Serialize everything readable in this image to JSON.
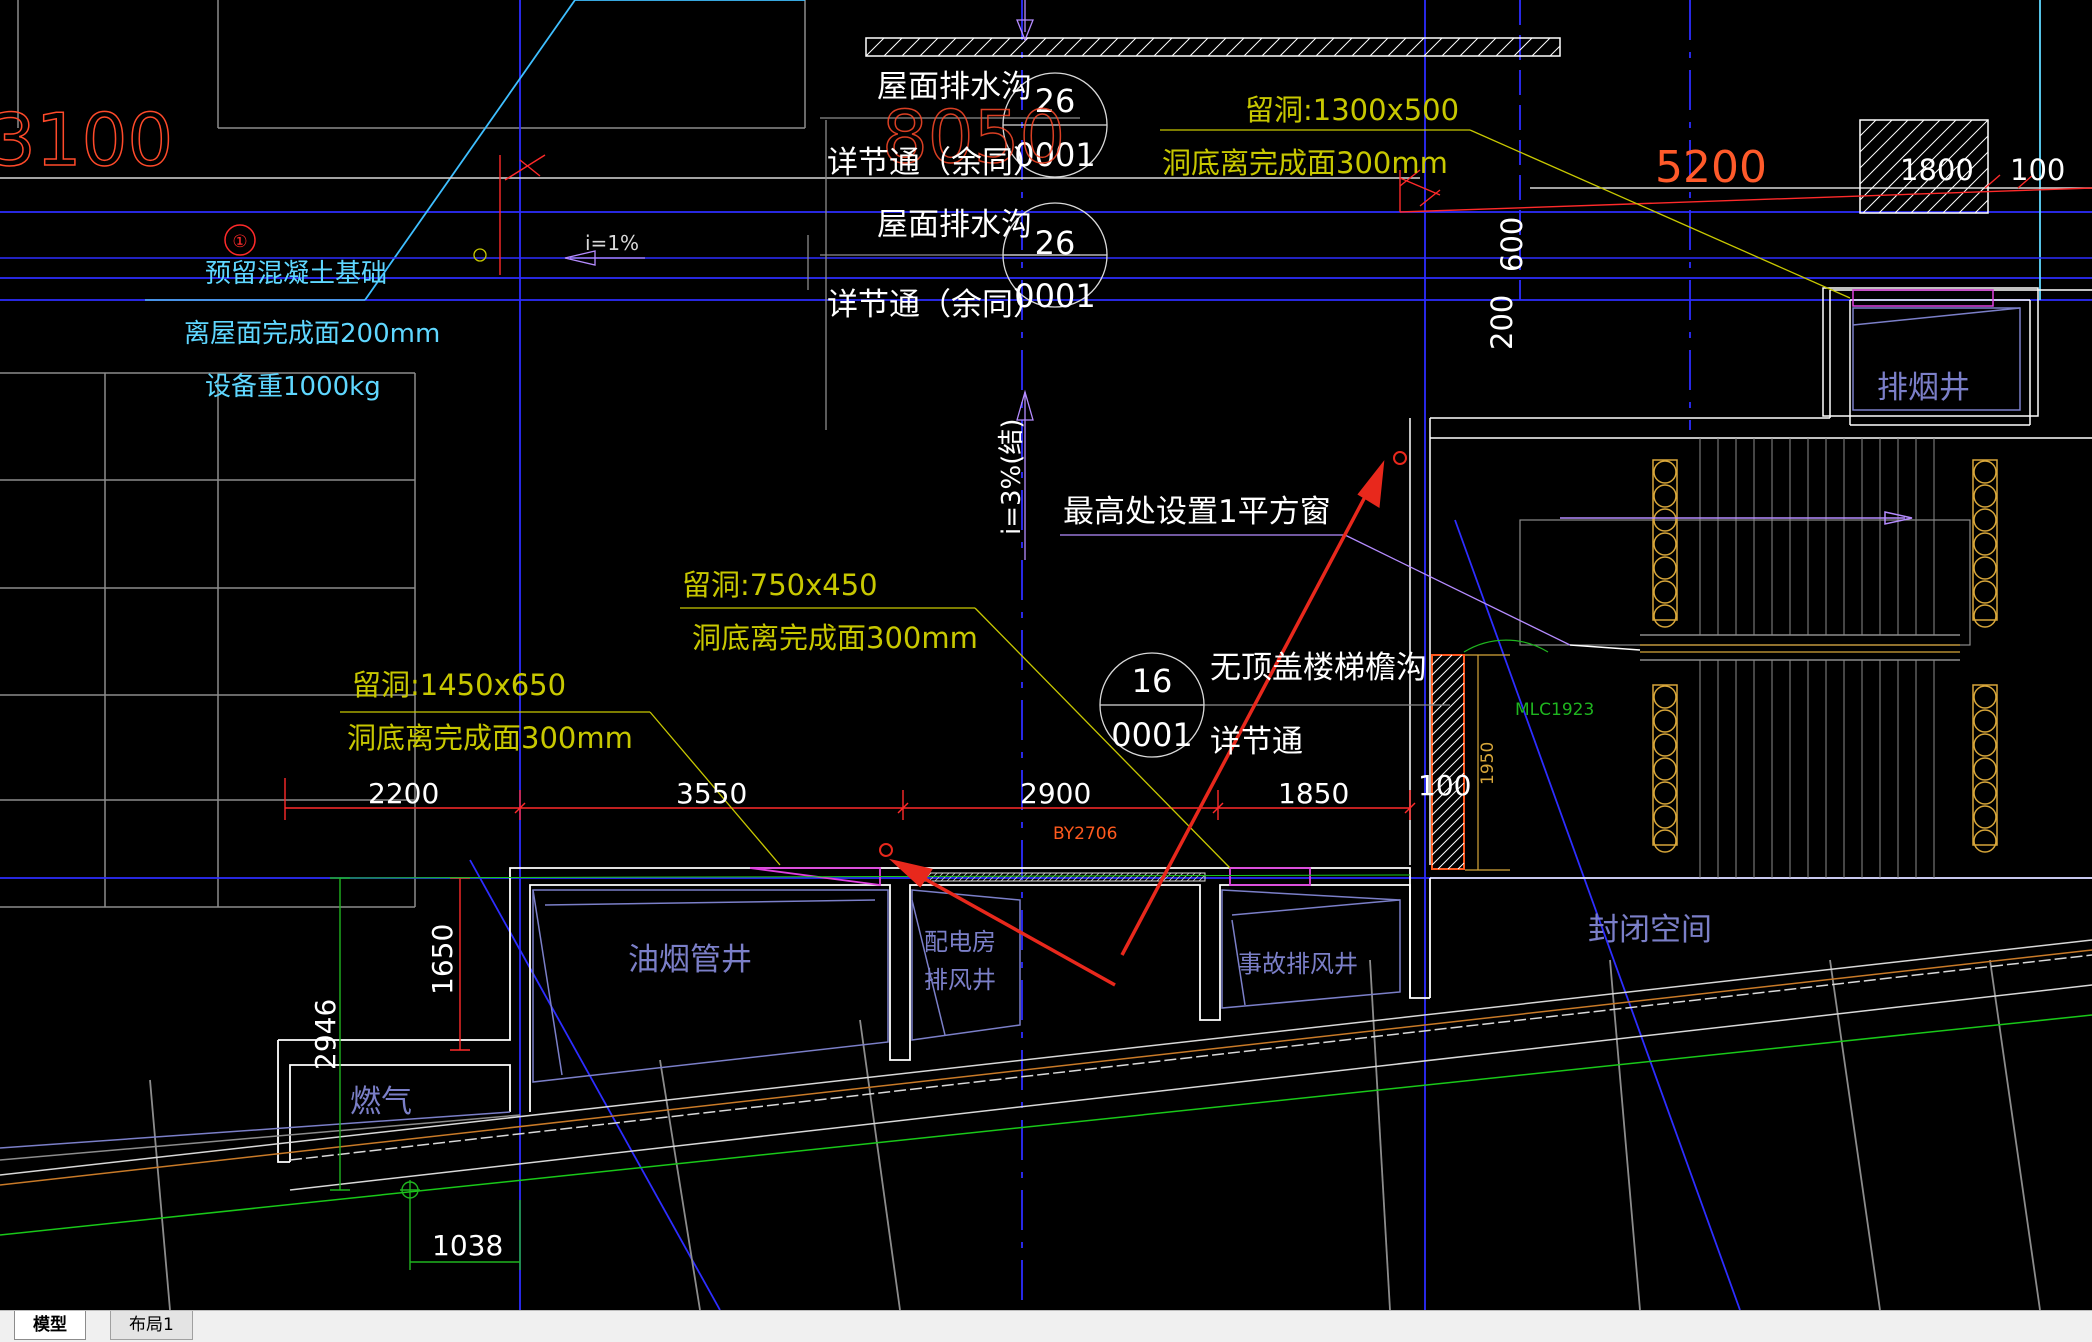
{
  "drawing": {
    "texts": {
      "big_3100": "3100",
      "big_8050": "8050",
      "big_5200": "5200",
      "roof_drain_1": "屋面排水沟",
      "detail_1": "详节通（余同）",
      "roof_drain_2": "屋面排水沟",
      "detail_2": "详节通（余同）",
      "hole_1300": "留洞:1300x500",
      "hole_1300_bottom": "洞底离完成面300mm",
      "dim_1800": "1800",
      "dim_100_top": "100",
      "dim_600": "600",
      "dim_200": "200",
      "slope_1": "i=1%",
      "foundation_1": "预留混凝土基础",
      "foundation_2": "离屋面完成面200mm",
      "foundation_3": "设备重1000kg",
      "slope_3": "i=3%(结)",
      "window_note": "最高处设置1平方窗",
      "hole_750": "留洞:750x450",
      "hole_750_bottom": "洞底离完成面300mm",
      "hole_1450": "留洞:1450x650",
      "hole_1450_bottom": "洞底离完成面300mm",
      "stair_gutter": "无顶盖楼梯檐沟",
      "stair_detail": "详节通",
      "dim_2200": "2200",
      "dim_3550": "3550",
      "dim_2900": "2900",
      "dim_1850": "1850",
      "dim_100_mid": "100",
      "dim_1950": "1950",
      "door_tag": "MLC1923",
      "beam_tag": "BY2706",
      "smoke_shaft": "排烟井",
      "oil_shaft": "油烟管井",
      "power_room_1": "配电房",
      "power_room_2": "排风井",
      "accident_exhaust": "事故排风井",
      "closed_space": "封闭空间",
      "gas": "燃气",
      "dim_1650": "1650",
      "dim_2946": "2946",
      "dim_1038": "1038"
    },
    "detail_markers": [
      {
        "top": "26",
        "bottom": "0001"
      },
      {
        "top": "26",
        "bottom": "0001"
      },
      {
        "top": "16",
        "bottom": "0001"
      }
    ],
    "axis_symbol": "①",
    "colors": {
      "background": "#000000",
      "wall": "#ffffff",
      "axis_line": "#2d2dff",
      "dimension": "#ff2a2a",
      "annotation_yellow": "#c8c800",
      "annotation_cyan": "#5fd7ff",
      "room_label": "#7b7fc8",
      "stair_orange": "#d7a63a",
      "leader_purple": "#b58cff",
      "hole_magenta": "#e040e0",
      "pointer_red": "#e8281c",
      "ground_green": "#19c819",
      "ground_orange": "#c87a28",
      "door_green": "#1fb51f"
    }
  },
  "tabs": [
    {
      "label": "模型",
      "active": true
    },
    {
      "label": "布局1",
      "active": false
    }
  ]
}
